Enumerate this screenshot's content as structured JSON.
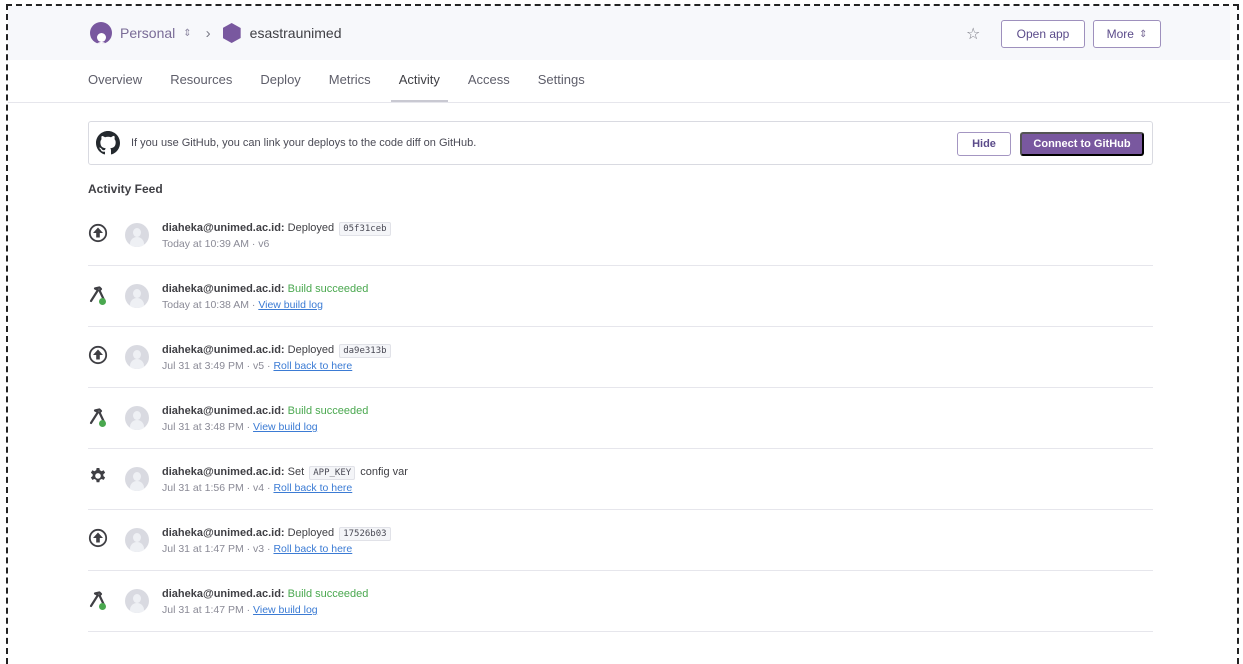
{
  "header": {
    "account": "Personal",
    "app_name": "esastraunimed",
    "open_app_label": "Open app",
    "more_label": "More"
  },
  "tabs": [
    {
      "label": "Overview"
    },
    {
      "label": "Resources"
    },
    {
      "label": "Deploy"
    },
    {
      "label": "Metrics"
    },
    {
      "label": "Activity",
      "active": true
    },
    {
      "label": "Access"
    },
    {
      "label": "Settings"
    }
  ],
  "github_banner": {
    "text": "If you use GitHub, you can link your deploys to the code diff on GitHub.",
    "hide_label": "Hide",
    "connect_label": "Connect to GitHub"
  },
  "feed": {
    "title": "Activity Feed",
    "items": [
      {
        "icon": "deploy-icon",
        "user": "diaheka@unimed.ac.id:",
        "action": "Deployed",
        "code": "05f31ceb",
        "after": "",
        "success": false,
        "time": "Today at 10:39 AM · v6",
        "link": ""
      },
      {
        "icon": "build-icon",
        "user": "diaheka@unimed.ac.id:",
        "action": "Build succeeded",
        "code": "",
        "after": "",
        "success": true,
        "time": "Today at 10:38 AM · ",
        "link": "View build log"
      },
      {
        "icon": "deploy-icon",
        "user": "diaheka@unimed.ac.id:",
        "action": "Deployed",
        "code": "da9e313b",
        "after": "",
        "success": false,
        "time": "Jul 31 at 3:49 PM · v5 · ",
        "link": "Roll back to here"
      },
      {
        "icon": "build-icon",
        "user": "diaheka@unimed.ac.id:",
        "action": "Build succeeded",
        "code": "",
        "after": "",
        "success": true,
        "time": "Jul 31 at 3:48 PM · ",
        "link": "View build log"
      },
      {
        "icon": "gear-icon",
        "user": "diaheka@unimed.ac.id:",
        "action": "Set",
        "code": "APP_KEY",
        "after": "config var",
        "success": false,
        "time": "Jul 31 at 1:56 PM · v4 · ",
        "link": "Roll back to here"
      },
      {
        "icon": "deploy-icon",
        "user": "diaheka@unimed.ac.id:",
        "action": "Deployed",
        "code": "17526b03",
        "after": "",
        "success": false,
        "time": "Jul 31 at 1:47 PM · v3 · ",
        "link": "Roll back to here"
      },
      {
        "icon": "build-icon",
        "user": "diaheka@unimed.ac.id:",
        "action": "Build succeeded",
        "code": "",
        "after": "",
        "success": true,
        "time": "Jul 31 at 1:47 PM · ",
        "link": "View build log"
      }
    ]
  },
  "colors": {
    "brand": "#79589f",
    "success": "#4aa84f",
    "link": "#3b7bd4"
  }
}
